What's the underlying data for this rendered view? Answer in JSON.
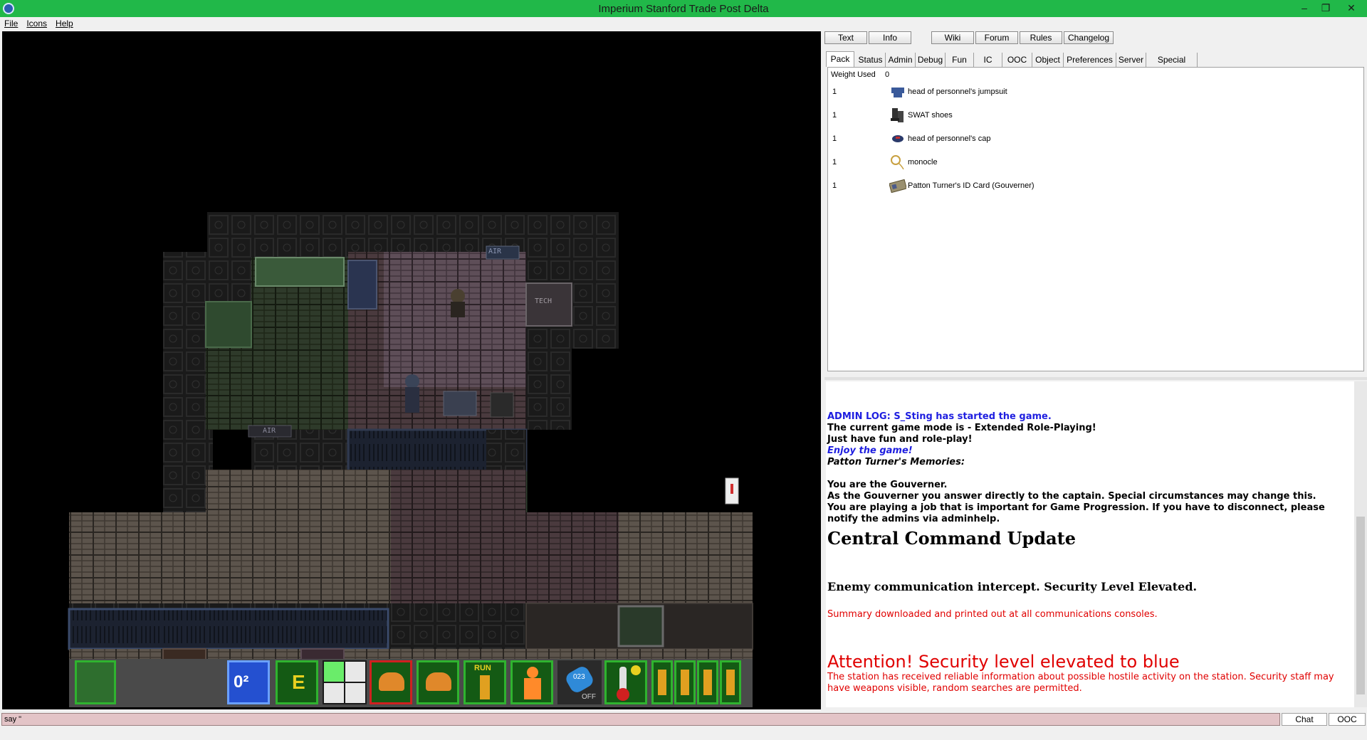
{
  "window": {
    "title": "Imperium Stanford Trade Post Delta",
    "controls": [
      "–",
      "❐",
      "✕"
    ]
  },
  "menu": [
    "File",
    "Icons",
    "Help"
  ],
  "top_buttons": [
    "Text",
    "Info",
    "Wiki",
    "Forum",
    "Rules",
    "Changelog"
  ],
  "tabs": [
    "Pack",
    "Status",
    "Admin",
    "Debug",
    "Fun",
    "IC",
    "OOC",
    "Object",
    "Preferences",
    "Server",
    "Special Verbs"
  ],
  "inventory": {
    "weight_label": "Weight Used",
    "weight_value": "0",
    "items": [
      {
        "count": "1",
        "name": "head of personnel's jumpsuit",
        "icon": "jumpsuit-icon"
      },
      {
        "count": "1",
        "name": "SWAT shoes",
        "icon": "boots-icon"
      },
      {
        "count": "1",
        "name": "head of personnel's cap",
        "icon": "cap-icon"
      },
      {
        "count": "1",
        "name": "monocle",
        "icon": "monocle-icon"
      },
      {
        "count": "1",
        "name": "Patton Turner's ID Card (Gouverner)",
        "icon": "id-card-icon"
      }
    ]
  },
  "chat": {
    "admin_log_prefix": "ADMIN LOG:",
    "admin_log_text": "S_Sting has started the game.",
    "mode_line": "The current game mode is - Extended Role-Playing!",
    "fun_line": "Just have fun and role-play!",
    "enjoy_line": "Enjoy the game!",
    "memories_line": "Patton Turner's Memories:",
    "role_line": "You are the Gouverner.",
    "answer_line": "As the Gouverner you answer directly to the captain. Special circumstances may change this.",
    "important_line": "You are playing a job that is important for Game Progression. If you have to disconnect, please notify the admins via adminhelp.",
    "cc_heading": "Central Command Update",
    "intercept_line": "Enemy communication intercept.  Security Level Elevated.",
    "summary_line": "Summary downloaded and printed out at all communications consoles.",
    "attention_heading": "Attention! Security level elevated to blue",
    "attention_body": "The station has received reliable information about possible hostile activity on the station. Security staff may have weapons visible, random searches are permitted."
  },
  "input": {
    "value": "say \"",
    "chat_button": "Chat",
    "ooc_button": "OOC"
  },
  "hud": {
    "oxygen_label": "0²",
    "intent_letter": "E",
    "run_label": "RUN",
    "internals_label": "OFF",
    "internals_value": "023",
    "map_signs": [
      "AIR",
      "TECH",
      "AIR"
    ]
  },
  "colors": {
    "titlebar": "#21b849",
    "hud_green": "#2fb32f",
    "admin_blue": "#1e1ee0",
    "alert_red": "#e00000",
    "input_pink": "#e3c4c7"
  }
}
